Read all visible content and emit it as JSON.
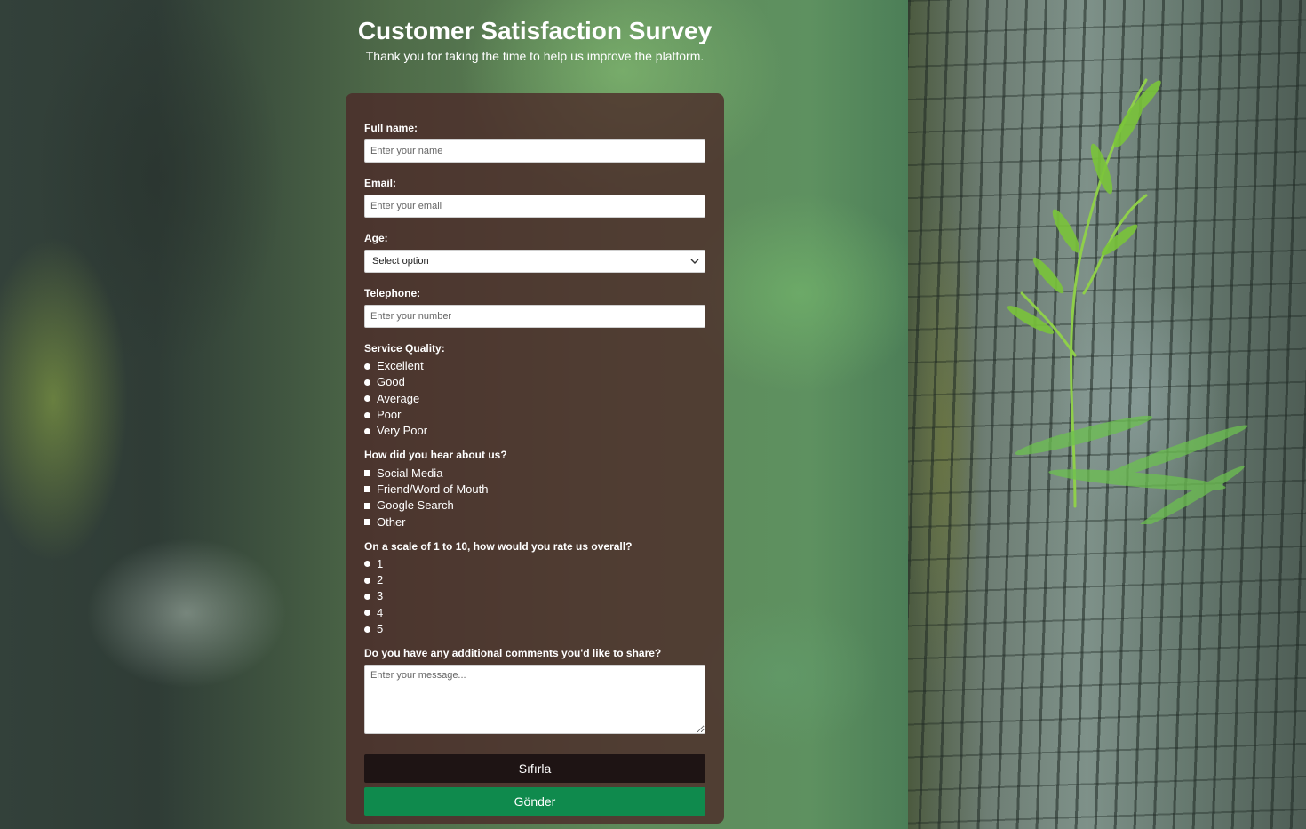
{
  "header": {
    "title": "Customer Satisfaction Survey",
    "subtitle": "Thank you for taking the time to help us improve the platform."
  },
  "form": {
    "full_name": {
      "label": "Full name:",
      "placeholder": "Enter your name",
      "value": ""
    },
    "email": {
      "label": "Email:",
      "placeholder": "Enter your email",
      "value": ""
    },
    "age": {
      "label": "Age:",
      "selected": "Select option"
    },
    "telephone": {
      "label": "Telephone:",
      "placeholder": "Enter your number",
      "value": ""
    },
    "service_quality": {
      "label": "Service Quality:",
      "options": [
        "Excellent",
        "Good",
        "Average",
        "Poor",
        "Very Poor"
      ]
    },
    "hear_about": {
      "label": "How did you hear about us?",
      "options": [
        "Social Media",
        "Friend/Word of Mouth",
        "Google Search",
        "Other"
      ]
    },
    "overall_rating": {
      "label": "On a scale of 1 to 10, how would you rate us overall?",
      "options": [
        "1",
        "2",
        "3",
        "4",
        "5"
      ]
    },
    "comments": {
      "label": "Do you have any additional comments you'd like to share?",
      "placeholder": "Enter your message..."
    },
    "reset_label": "Sıfırla",
    "submit_label": "Gönder"
  },
  "colors": {
    "card_bg": "#4b2828",
    "reset_button": "#1e1414",
    "submit_button": "#0f8a4d",
    "text": "#ffffff"
  },
  "icons": {
    "select_arrow": "chevron-down-icon",
    "radio": "radio-icon",
    "checkbox": "checkbox-icon"
  }
}
